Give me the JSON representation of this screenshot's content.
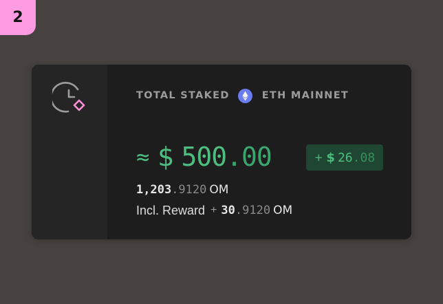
{
  "step_badge": "2",
  "card": {
    "clock_icon": "clock-with-diamond-icon",
    "header": {
      "label": "TOTAL STAKED",
      "network_icon": "ethereum-icon",
      "network": "ETH MAINNET"
    },
    "value": {
      "approx": "≈",
      "currency": "$",
      "integer": "500",
      "decimal": ".00"
    },
    "change": {
      "sign": "+",
      "currency": "$",
      "integer": "26",
      "decimal": ".08"
    },
    "token_amount": {
      "integer": "1,203",
      "decimal": ".9120",
      "unit": "OM"
    },
    "reward": {
      "label": "Incl. Reward",
      "sign": "+",
      "integer": "30",
      "decimal": ".9120",
      "unit": "OM"
    }
  },
  "colors": {
    "background": "#47423f",
    "card": "#1d1d1d",
    "sidebar": "#252525",
    "badge": "#ff9be3",
    "accent_green": "#4dbd80",
    "pill_bg": "#1f4632",
    "eth_blue": "#6b7cf0"
  }
}
